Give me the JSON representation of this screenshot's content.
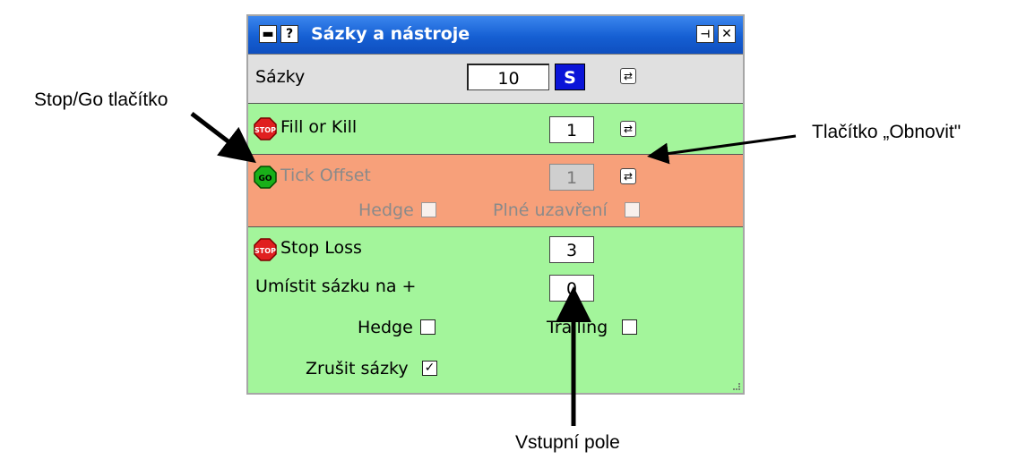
{
  "callouts": {
    "stopgo": "Stop/Go tlačítko",
    "refresh": "Tlačítko „Obnovit\"",
    "input": "Vstupní pole"
  },
  "window": {
    "title": "Sázky a nástroje",
    "title_buttons": [
      "minimize-icon",
      "help-icon",
      "pin-icon",
      "close-icon"
    ],
    "colors": {
      "titlebar": "#155fd3",
      "green_row": "#a3f59b",
      "orange_row": "#f7a07a",
      "s_button": "#0a14d8"
    }
  },
  "sazky": {
    "label": "Sázky",
    "value": "10",
    "s_label": "S"
  },
  "fill_or_kill": {
    "state_icon": "STOP",
    "label": "Fill or Kill",
    "value": "1"
  },
  "tick_offset": {
    "state_icon": "GO",
    "label": "Tick Offset",
    "value": "1",
    "hedge_label": "Hedge",
    "hedge_checked": false,
    "full_close_label": "Plné uzavření",
    "full_close_checked": false
  },
  "stop_loss": {
    "state_icon": "STOP",
    "label": "Stop Loss",
    "value": "3",
    "place_bet_label": "Umístit sázku na +",
    "place_bet_value": "0",
    "hedge_label": "Hedge",
    "hedge_checked": false,
    "trailing_label": "Trailing",
    "trailing_checked": false,
    "cancel_bets_label": "Zrušit sázky",
    "cancel_bets_checked": true
  }
}
